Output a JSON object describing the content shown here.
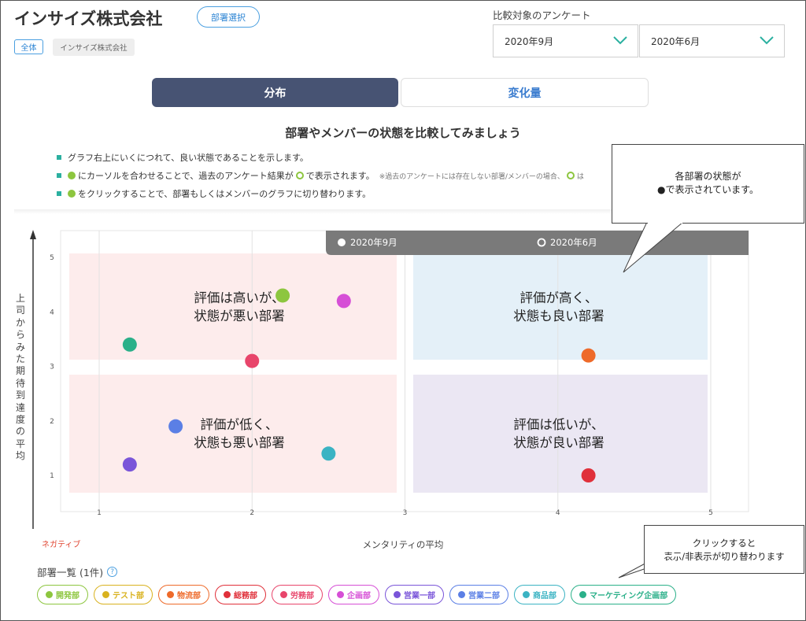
{
  "header": {
    "company_title": "インサイズ株式会社",
    "dept_select_button": "部署選択",
    "tag_all": "全体",
    "tag_company": "インサイズ株式会社",
    "compare_label": "比較対象のアンケート",
    "survey_a": "2020年9月",
    "survey_b": "2020年6月"
  },
  "tabs": {
    "distribution": "分布",
    "change": "変化量"
  },
  "intro": {
    "heading": "部署やメンバーの状態を比較してみましょう",
    "bullet1": "グラフ右上にいくにつれて、良い状態であることを示します。",
    "bullet2_a": "にカーソルを合わせることで、過去のアンケート結果が",
    "bullet2_b": "で表示されます。",
    "bullet2_note": "※過去のアンケートには存在しない部署/メンバーの場合、",
    "bullet2_tail": "は",
    "bullet3": "をクリックすることで、部署もしくはメンバーのグラフに切り替わります。"
  },
  "chart_data": {
    "type": "scatter",
    "xlabel": "メンタリティの平均",
    "ylabel": "上司からみた期待到達度の平均",
    "x_negative_label": "ネガティブ",
    "xlim": [
      0.5,
      5.0
    ],
    "ylim": [
      0.6,
      5.3
    ],
    "x_ticks": [
      "1",
      "2",
      "3",
      "4",
      "5"
    ],
    "y_ticks": [
      "1",
      "2",
      "3",
      "4",
      "5"
    ],
    "legend": {
      "current": "2020年9月",
      "previous": "2020年6月"
    },
    "quadrants": {
      "top_left": [
        "評価は高いが、",
        "状態が悪い部署"
      ],
      "top_right": [
        "評価が高く、",
        "状態も良い部署"
      ],
      "bottom_left": [
        "評価が低く、",
        "状態も悪い部署"
      ],
      "bottom_right": [
        "評価は低いが、",
        "状態が良い部署"
      ]
    },
    "points": [
      {
        "x": 2.2,
        "y": 4.3,
        "color": "#8dc63f"
      },
      {
        "x": 2.6,
        "y": 4.2,
        "color": "#d64fd6"
      },
      {
        "x": 1.2,
        "y": 3.4,
        "color": "#2bb089"
      },
      {
        "x": 2.0,
        "y": 3.1,
        "color": "#e8456b"
      },
      {
        "x": 4.2,
        "y": 3.2,
        "color": "#ee6a2a"
      },
      {
        "x": 1.5,
        "y": 1.9,
        "color": "#5b7fe5"
      },
      {
        "x": 2.5,
        "y": 1.4,
        "color": "#3bb3c3"
      },
      {
        "x": 1.2,
        "y": 1.2,
        "color": "#7a55d9"
      },
      {
        "x": 4.2,
        "y": 1.0,
        "color": "#e0303a"
      }
    ]
  },
  "callouts": {
    "status_line1": "各部署の状態が",
    "status_line2": "●で表示されています。",
    "toggle_line1": "クリックすると",
    "toggle_line2": "表示/非表示が切り替わります"
  },
  "department_list": {
    "label": "部署一覧 (1件)",
    "help_icon": "?",
    "items": [
      {
        "name": "開発部",
        "color": "#8dc63f"
      },
      {
        "name": "テスト部",
        "color": "#d9b21f"
      },
      {
        "name": "物流部",
        "color": "#ee6a2a"
      },
      {
        "name": "総務部",
        "color": "#e0303a"
      },
      {
        "name": "労務部",
        "color": "#e8456b"
      },
      {
        "name": "企画部",
        "color": "#d64fd6"
      },
      {
        "name": "営業一部",
        "color": "#7a55d9"
      },
      {
        "name": "営業二部",
        "color": "#5b7fe5"
      },
      {
        "name": "商品部",
        "color": "#3bb3c3"
      },
      {
        "name": "マーケティング企画部",
        "color": "#2bb089"
      }
    ]
  }
}
